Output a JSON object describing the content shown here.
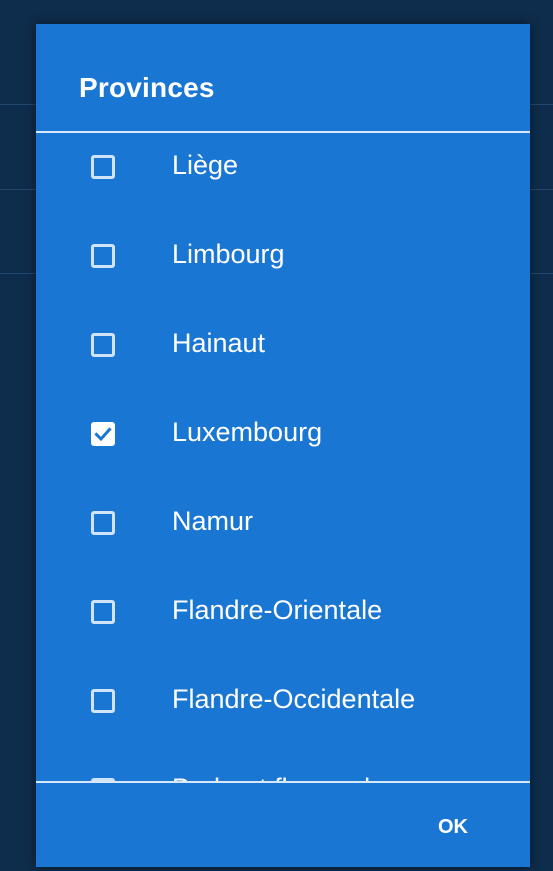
{
  "dialog": {
    "title": "Provinces",
    "ok_label": "OK",
    "options": [
      {
        "label": "Liège",
        "checked": false
      },
      {
        "label": "Limbourg",
        "checked": false
      },
      {
        "label": "Hainaut",
        "checked": false
      },
      {
        "label": "Luxembourg",
        "checked": true
      },
      {
        "label": "Namur",
        "checked": false
      },
      {
        "label": "Flandre-Orientale",
        "checked": false
      },
      {
        "label": "Flandre-Occidentale",
        "checked": false
      },
      {
        "label": "Brabant flamand",
        "checked": false
      }
    ]
  },
  "colors": {
    "dialog_background": "#1976d2",
    "backdrop": "#0e2c4b",
    "divider": "#d6e8fa",
    "text": "#ffffff"
  }
}
